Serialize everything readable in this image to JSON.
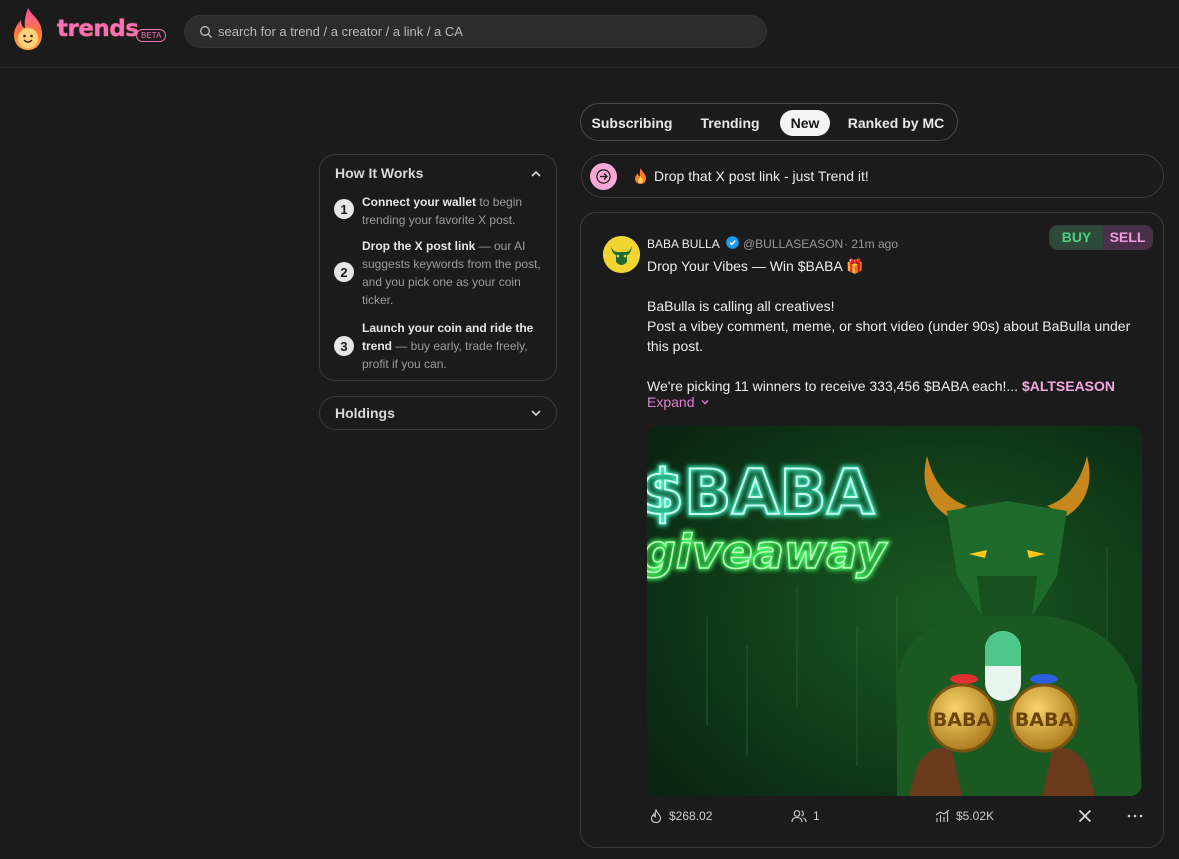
{
  "header": {
    "logo_text": "trends",
    "beta_label": "BETA",
    "search_placeholder": "search for a trend / a creator / a link / a CA"
  },
  "tabs": [
    {
      "label": "Subscribing",
      "active": false
    },
    {
      "label": "Trending",
      "active": false
    },
    {
      "label": "New",
      "active": true
    },
    {
      "label": "Ranked by MC",
      "active": false
    }
  ],
  "how_it_works": {
    "title": "How It Works",
    "steps": [
      {
        "num": "1",
        "bold": "Connect your wallet",
        "rest": " to begin trending your favorite X post."
      },
      {
        "num": "2",
        "bold": "Drop the X post link",
        "rest": " — our AI suggests keywords from the post, and you pick one as your coin ticker."
      },
      {
        "num": "3",
        "bold": "Launch your coin and ride the trend",
        "rest": " — buy early, trade freely, profit if you can."
      }
    ]
  },
  "holdings": {
    "label": "Holdings"
  },
  "drop_bar": {
    "text": "Drop that X post link - just Trend it!"
  },
  "post": {
    "author": "BABA BULLA",
    "handle": "@BULLASEASON",
    "time": "· 21m ago",
    "buy_label": "BUY",
    "sell_label": "SELL",
    "headline": "Drop Your Vibes — Win $BABA 🎁",
    "para1": "BaBulla is calling all creatives!",
    "para2": "Post a vibey comment, meme, or short video (under 90s) about BaBulla under this post.",
    "para3": "We're picking 11 winners to receive 333,456 $BABA each!...",
    "tag": "$ALTSEASON",
    "expand_label": "Expand",
    "image_text_1": "$BABA",
    "image_text_2": "giveaway",
    "coin_label": "BABA",
    "stats": {
      "volume": "$268.02",
      "holders": "1",
      "market_cap": "$5.02K"
    }
  },
  "colors": {
    "accent_pink": "#f7a8d8",
    "buy_green": "#48d27c",
    "sell_pink": "#f09ae0",
    "background": "#1b1b1b"
  }
}
